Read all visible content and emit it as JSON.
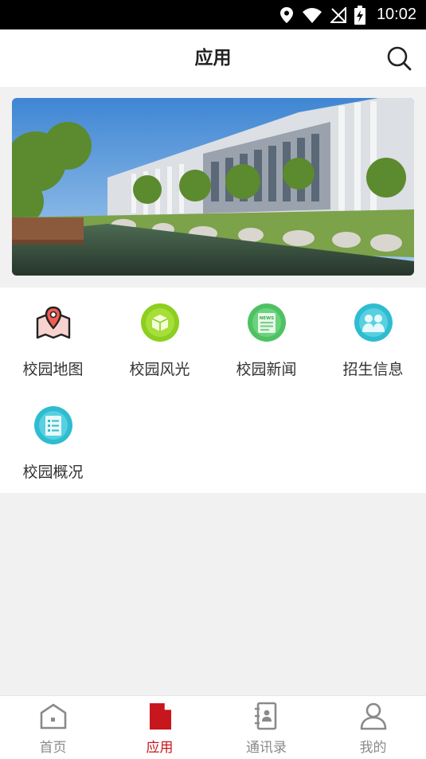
{
  "status_bar": {
    "time": "10:02"
  },
  "header": {
    "title": "应用"
  },
  "apps": [
    {
      "label": "校园地图",
      "icon": "map-pin-icon"
    },
    {
      "label": "校园风光",
      "icon": "scenery-icon"
    },
    {
      "label": "校园新闻",
      "icon": "news-icon"
    },
    {
      "label": "招生信息",
      "icon": "people-icon"
    },
    {
      "label": "校园概况",
      "icon": "overview-icon"
    }
  ],
  "tabs": [
    {
      "label": "首页",
      "icon": "home-icon"
    },
    {
      "label": "应用",
      "icon": "document-icon",
      "active": true
    },
    {
      "label": "通讯录",
      "icon": "contacts-icon"
    },
    {
      "label": "我的",
      "icon": "user-icon"
    }
  ],
  "colors": {
    "accent": "#c7161d",
    "background": "#f1f1f1"
  }
}
